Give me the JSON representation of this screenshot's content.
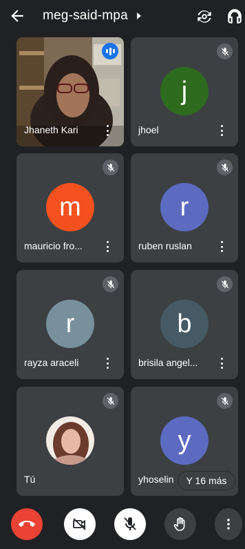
{
  "header": {
    "title": "meg-said-mpa",
    "back_icon": "arrow-left-icon",
    "rotate_icon": "camera-switch-icon",
    "audio_icon": "headphones-icon"
  },
  "participants": [
    {
      "name": "Jhaneth Kari",
      "video": true,
      "muted": false,
      "speaking": true
    },
    {
      "name": "jhoel",
      "initial": "j",
      "color": "#2e6b1f",
      "muted": true
    },
    {
      "name": "mauricio fro...",
      "initial": "m",
      "color": "#f4511e",
      "muted": true
    },
    {
      "name": "ruben ruslan",
      "initial": "r",
      "color": "#5c6bc0",
      "muted": true
    },
    {
      "name": "rayza araceli",
      "initial": "r",
      "color": "#78909c",
      "muted": true
    },
    {
      "name": "brisila angel...",
      "initial": "b",
      "color": "#455a64",
      "muted": true
    },
    {
      "name": "Tú",
      "photo": true,
      "muted": true
    },
    {
      "name": "yhoselin",
      "initial": "y",
      "color": "#5c6bc0",
      "muted": true
    }
  ],
  "more_participants_label": "Y 16 más",
  "controls": {
    "hangup_color": "#ea4335",
    "items": [
      "hang-up",
      "camera-off",
      "mic-off",
      "raise-hand",
      "more-options"
    ]
  }
}
